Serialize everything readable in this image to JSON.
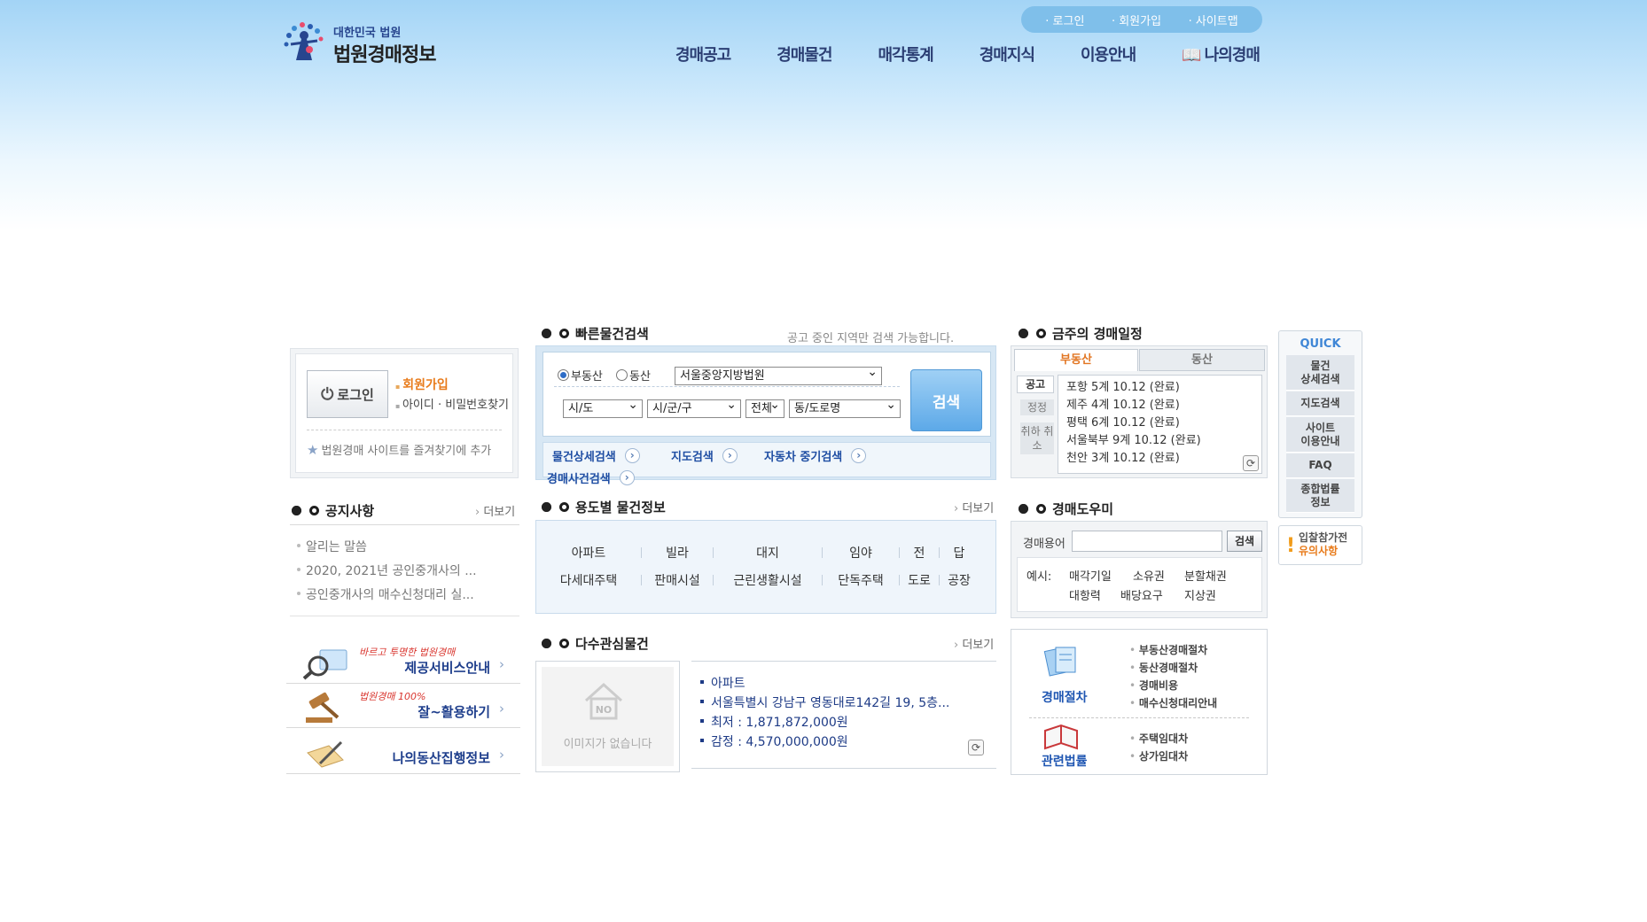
{
  "header": {
    "logo_small": "대한민국 법원",
    "logo_big": "법원경매정보"
  },
  "util": [
    "로그인",
    "회원가입",
    "사이트맵"
  ],
  "gnb": [
    "경매공고",
    "경매물건",
    "매각통계",
    "경매지식",
    "이용안내",
    "나의경매"
  ],
  "login": {
    "button": "로그인",
    "signup": "회원가입",
    "find": "아이디 · 비밀번호찾기",
    "favorite": "법원경매 사이트를 즐겨찾기에 추가"
  },
  "notice": {
    "title": "공지사항",
    "more": "더보기",
    "items": [
      "알리는 말씀",
      "2020, 2021년 공인중개사의 ...",
      "공인중개사의 매수신청대리 실..."
    ]
  },
  "banners": [
    {
      "sub": "바르고 투명한 법원경매",
      "main": "제공서비스안내"
    },
    {
      "sub": "법원경매 100%",
      "main": "잘~활용하기"
    },
    {
      "sub": "",
      "main": "나의동산집행정보"
    }
  ],
  "quick_search": {
    "title": "빠른물건검색",
    "note": "공고 중인 지역만 검색 가능합니다.",
    "radio_real": "부동산",
    "radio_movable": "동산",
    "court": "서울중앙지방법원",
    "sido": "시/도",
    "sigungu": "시/군/구",
    "all": "전체",
    "dong": "동/도로명",
    "search": "검색",
    "links": [
      "물건상세검색",
      "지도검색",
      "자동차 중기검색",
      "경매사건검색"
    ]
  },
  "usage": {
    "title": "용도별 물건정보",
    "more": "더보기",
    "row1": [
      "아파트",
      "빌라",
      "대지",
      "임야",
      "전",
      "답"
    ],
    "row2": [
      "다세대주택",
      "판매시설",
      "근린생활시설",
      "단독주택",
      "도로",
      "공장"
    ]
  },
  "popular": {
    "title": "다수관심물건",
    "more": "더보기",
    "no_image_mark": "NO",
    "no_image": "이미지가 없습니다",
    "items": [
      "아파트",
      "서울특별시 강남구 영동대로142길 19, 5층...",
      "최저 : 1,871,872,000원",
      "감정 : 4,570,000,000원"
    ]
  },
  "schedule": {
    "title": "금주의 경매일정",
    "tab_real": "부동산",
    "tab_movable": "동산",
    "side": [
      "공고",
      "정정",
      "취하 취소"
    ],
    "items": [
      "포항 5계 10.12 (완료)",
      "제주 4계 10.12 (완료)",
      "평택 6계 10.12 (완료)",
      "서울북부 9계 10.12 (완료)",
      "천안 3계 10.12 (완료)"
    ]
  },
  "helper": {
    "title": "경매도우미",
    "label": "경매용어",
    "button": "검색",
    "example_label": "예시:",
    "examples": [
      "매각기일",
      "소유권",
      "분할채권",
      "대항력",
      "배당요구",
      "지상권"
    ]
  },
  "procedure": {
    "cap1": "경매절차",
    "list1": [
      "부동산경매절차",
      "동산경매절차",
      "경매비용",
      "매수신청대리안내"
    ],
    "cap2": "관련법률",
    "list2": [
      "주택임대차",
      "상가임대차"
    ]
  },
  "quick_menu": {
    "title": "QUICK",
    "items": [
      "물건\n상세검색",
      "지도검색",
      "사이트\n이용안내",
      "FAQ",
      "종합법률\n정보"
    ]
  },
  "caution": {
    "line1": "입찰참가전",
    "line2": "유의사항"
  },
  "colors": {
    "accent_blue": "#1f4ea3",
    "accent_orange": "#e87b1b",
    "header_bg": "#a3d4f6"
  }
}
